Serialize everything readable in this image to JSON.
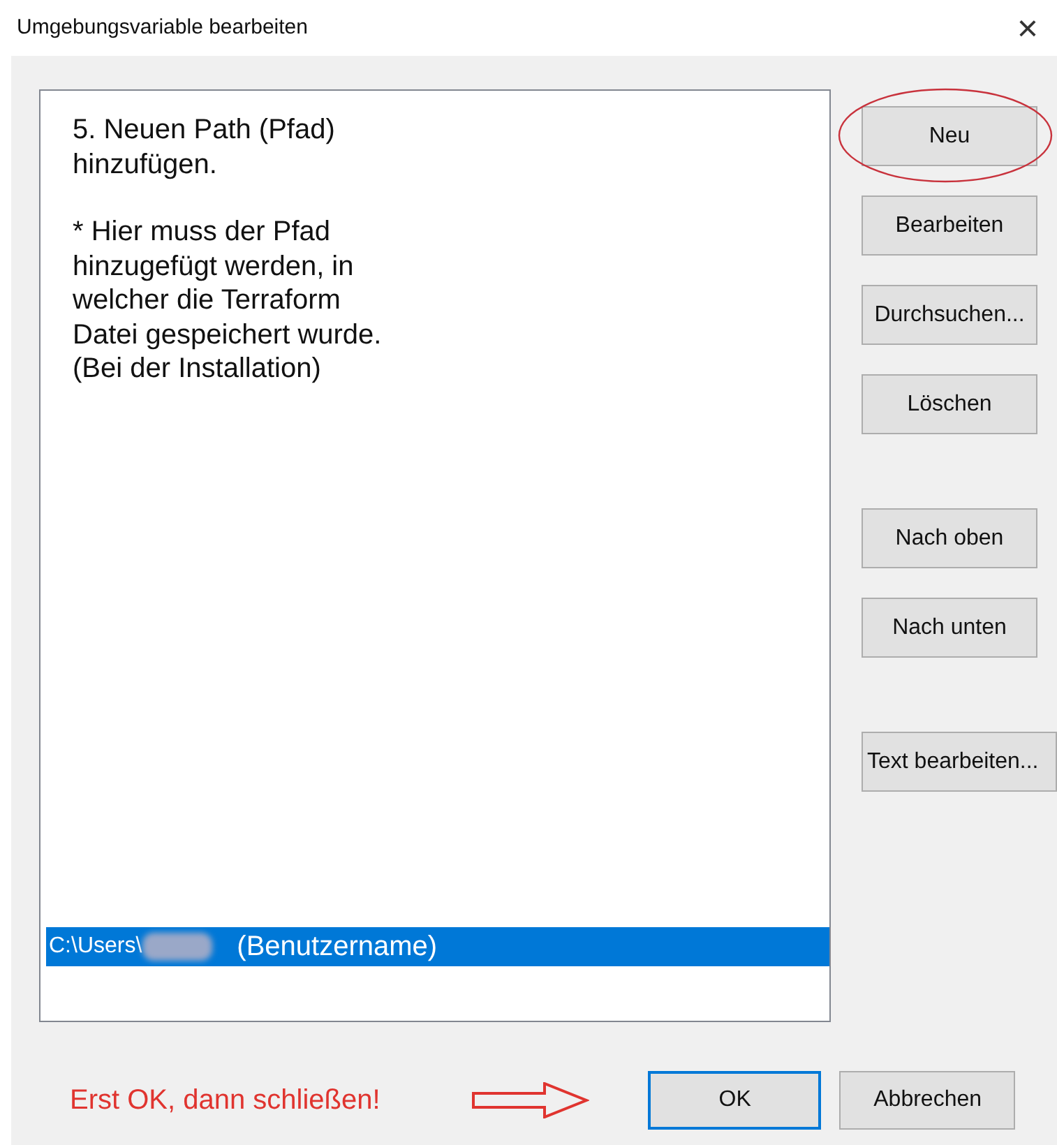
{
  "window": {
    "title": "Umgebungsvariable bearbeiten",
    "close": "×"
  },
  "list": {
    "items": [
      {
        "path": "C:\\Users\\",
        "redacted": true,
        "note": "(Benutzername)",
        "selected": true
      }
    ]
  },
  "side_button_groups": [
    [
      {
        "label": "Neu",
        "circled": true
      },
      {
        "label": "Bearbeiten",
        "circled": false
      },
      {
        "label": "Durchsuchen...",
        "circled": false
      },
      {
        "label": "Löschen",
        "circled": false
      }
    ],
    [
      {
        "label": "Nach oben",
        "circled": false
      },
      {
        "label": "Nach unten",
        "circled": false
      }
    ],
    [
      {
        "label": "Text bearbeiten...",
        "circled": false
      }
    ]
  ],
  "annotation": {
    "paragraphs": [
      [
        "5. Neuen Path (Pfad)",
        "hinzufügen."
      ],
      [
        "* Hier muss der Pfad",
        "hinzugefügt werden, in",
        "welcher die Terraform",
        "Datei gespeichert wurde.",
        "(Bei der Installation)"
      ]
    ],
    "footer_note": "Erst OK, dann schließen!",
    "arrow": true
  },
  "footer_buttons": [
    {
      "label": "OK",
      "default": true
    },
    {
      "label": "Abbrechen",
      "default": false
    }
  ]
}
